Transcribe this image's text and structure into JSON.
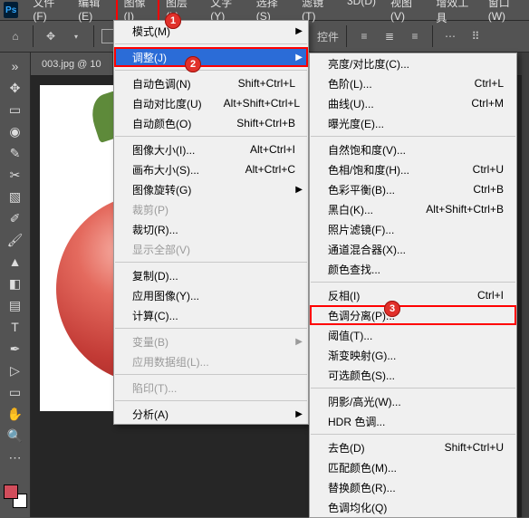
{
  "menubar": {
    "items": [
      "文件(F)",
      "编辑(E)",
      "图像(I)",
      "图层(L)",
      "文字(Y)",
      "选择(S)",
      "滤镜(T)",
      "3D(D)",
      "视图(V)",
      "增效工具",
      "窗口(W)"
    ],
    "highlight_index": 2
  },
  "optionsbar": {
    "controls_label": "控件"
  },
  "document": {
    "tab_title": "003.jpg @ 10"
  },
  "badges": {
    "b1": "1",
    "b2": "2",
    "b3": "3"
  },
  "image_menu": {
    "groups": [
      [
        {
          "label": "模式(M)",
          "arrow": true
        }
      ],
      [
        {
          "label": "调整(J)",
          "arrow": true,
          "selected": true,
          "highlight": true
        }
      ],
      [
        {
          "label": "自动色调(N)",
          "accel": "Shift+Ctrl+L"
        },
        {
          "label": "自动对比度(U)",
          "accel": "Alt+Shift+Ctrl+L"
        },
        {
          "label": "自动颜色(O)",
          "accel": "Shift+Ctrl+B"
        }
      ],
      [
        {
          "label": "图像大小(I)...",
          "accel": "Alt+Ctrl+I"
        },
        {
          "label": "画布大小(S)...",
          "accel": "Alt+Ctrl+C"
        },
        {
          "label": "图像旋转(G)",
          "arrow": true
        },
        {
          "label": "裁剪(P)",
          "disabled": true
        },
        {
          "label": "裁切(R)..."
        },
        {
          "label": "显示全部(V)",
          "disabled": true
        }
      ],
      [
        {
          "label": "复制(D)..."
        },
        {
          "label": "应用图像(Y)..."
        },
        {
          "label": "计算(C)..."
        }
      ],
      [
        {
          "label": "变量(B)",
          "arrow": true,
          "disabled": true
        },
        {
          "label": "应用数据组(L)...",
          "disabled": true
        }
      ],
      [
        {
          "label": "陷印(T)...",
          "disabled": true
        }
      ],
      [
        {
          "label": "分析(A)",
          "arrow": true
        }
      ]
    ]
  },
  "adjust_menu": {
    "groups": [
      [
        {
          "label": "亮度/对比度(C)..."
        },
        {
          "label": "色阶(L)...",
          "accel": "Ctrl+L"
        },
        {
          "label": "曲线(U)...",
          "accel": "Ctrl+M"
        },
        {
          "label": "曝光度(E)..."
        }
      ],
      [
        {
          "label": "自然饱和度(V)..."
        },
        {
          "label": "色相/饱和度(H)...",
          "accel": "Ctrl+U"
        },
        {
          "label": "色彩平衡(B)...",
          "accel": "Ctrl+B"
        },
        {
          "label": "黑白(K)...",
          "accel": "Alt+Shift+Ctrl+B"
        },
        {
          "label": "照片滤镜(F)..."
        },
        {
          "label": "通道混合器(X)..."
        },
        {
          "label": "颜色查找..."
        }
      ],
      [
        {
          "label": "反相(I)",
          "accel": "Ctrl+I"
        },
        {
          "label": "色调分离(P)...",
          "highlight": true
        },
        {
          "label": "阈值(T)..."
        },
        {
          "label": "渐变映射(G)..."
        },
        {
          "label": "可选颜色(S)..."
        }
      ],
      [
        {
          "label": "阴影/高光(W)..."
        },
        {
          "label": "HDR 色调..."
        }
      ],
      [
        {
          "label": "去色(D)",
          "accel": "Shift+Ctrl+U"
        },
        {
          "label": "匹配颜色(M)..."
        },
        {
          "label": "替换颜色(R)..."
        },
        {
          "label": "色调均化(Q)"
        }
      ]
    ]
  }
}
